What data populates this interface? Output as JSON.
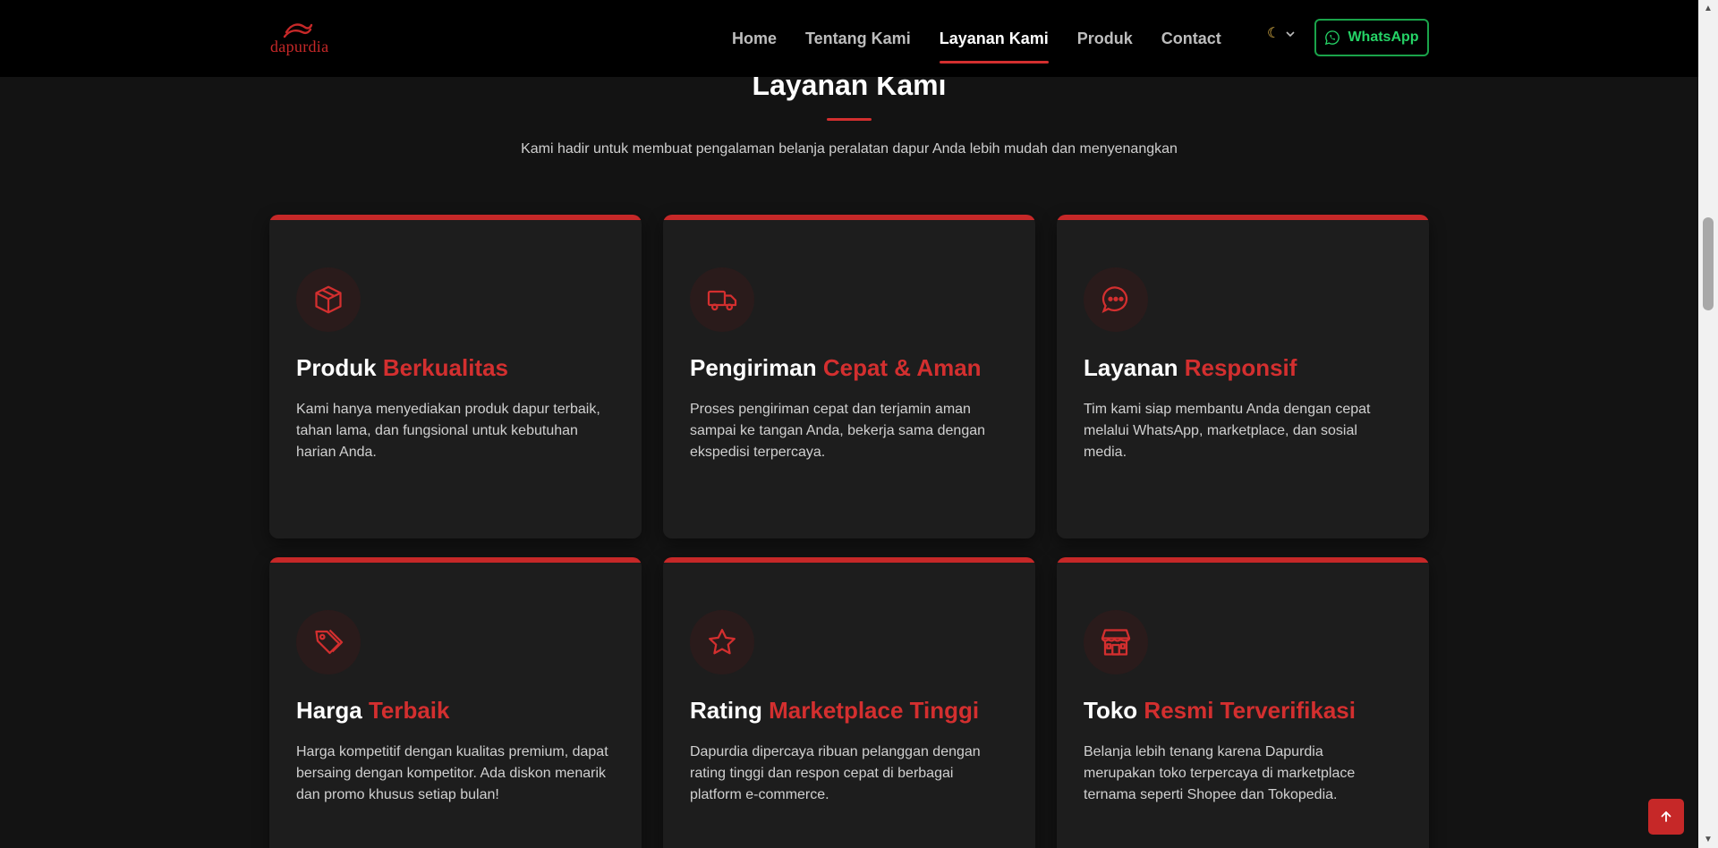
{
  "nav": {
    "logo_text": "dapurdia",
    "links": [
      {
        "label": "Home"
      },
      {
        "label": "Tentang Kami"
      },
      {
        "label": "Layanan Kami"
      },
      {
        "label": "Produk"
      },
      {
        "label": "Contact"
      }
    ],
    "active_link": "Layanan Kami",
    "theme_icon": "moon-icon",
    "whatsapp_label": "WhatsApp"
  },
  "section": {
    "title": "Layanan Kami",
    "subtitle": "Kami hadir untuk membuat pengalaman belanja peralatan dapur Anda lebih mudah dan menyenangkan"
  },
  "cards": [
    {
      "icon": "box-icon",
      "title_main": "Produk",
      "title_accent": "Berkualitas",
      "description": "Kami hanya menyediakan produk dapur terbaik, tahan lama, dan fungsional untuk kebutuhan harian Anda."
    },
    {
      "icon": "truck-icon",
      "title_main": "Pengiriman",
      "title_accent": "Cepat & Aman",
      "description": "Proses pengiriman cepat dan terjamin aman sampai ke tangan Anda, bekerja sama dengan ekspedisi terpercaya."
    },
    {
      "icon": "chat-icon",
      "title_main": "Layanan",
      "title_accent": "Responsif",
      "description": "Tim kami siap membantu Anda dengan cepat melalui WhatsApp, marketplace, dan sosial media."
    },
    {
      "icon": "tags-icon",
      "title_main": "Harga",
      "title_accent": "Terbaik",
      "description": "Harga kompetitif dengan kualitas premium, dapat bersaing dengan kompetitor. Ada diskon menarik dan promo khusus setiap bulan!"
    },
    {
      "icon": "star-icon",
      "title_main": "Rating",
      "title_accent": "Marketplace Tinggi",
      "description": "Dapurdia dipercaya ribuan pelanggan dengan rating tinggi dan respon cepat di berbagai platform e-commerce."
    },
    {
      "icon": "store-icon",
      "title_main": "Toko",
      "title_accent": "Resmi Terverifikasi",
      "description": "Belanja lebih tenang karena Dapurdia merupakan toko terpercaya di marketplace ternama seperti Shopee dan Tokopedia."
    }
  ],
  "colors": {
    "accent": "#d32f2f",
    "background": "#131313",
    "card": "#1d1d1d",
    "whatsapp": "#25d366"
  }
}
